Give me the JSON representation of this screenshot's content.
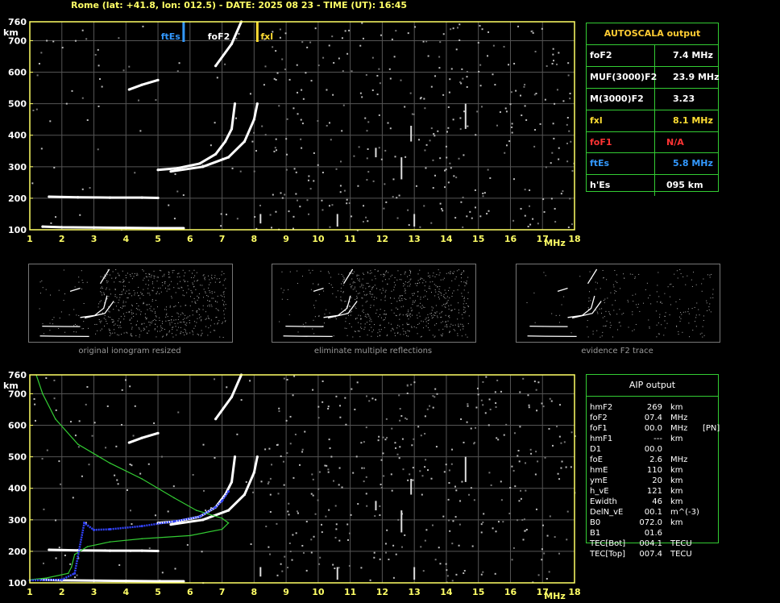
{
  "header": {
    "text": "Rome (lat: +41.8, lon: 012.5) - DATE: 2025 08 23 - TIME (UT): 16:45"
  },
  "colors": {
    "grid": "#555555",
    "axis": "#ffff66",
    "frame": "#33cc33",
    "ftes": "#3399ff",
    "foF1": "#ff3333",
    "fxl": "#ffdd33",
    "profile": "#33cc33",
    "scaled_trace": "#3344ff"
  },
  "top_chart": {
    "xlabel": "MHz",
    "ylabel": "km",
    "x_ticks": [
      "1",
      "2",
      "3",
      "4",
      "5",
      "6",
      "7",
      "8",
      "9",
      "10",
      "11",
      "12",
      "13",
      "14",
      "15",
      "16",
      "17",
      "18"
    ],
    "y_ticks": [
      "100",
      "200",
      "300",
      "400",
      "500",
      "600",
      "700",
      "760"
    ],
    "markers": [
      {
        "label": "ftEs",
        "freq": 5.8
      },
      {
        "label": "foF2",
        "freq": 7.4
      },
      {
        "label": "fxl",
        "freq": 8.1
      }
    ]
  },
  "bottom_chart": {
    "xlabel": "MHz",
    "ylabel": "km",
    "x_ticks": [
      "1",
      "2",
      "3",
      "4",
      "5",
      "6",
      "7",
      "8",
      "9",
      "10",
      "11",
      "12",
      "13",
      "14",
      "15",
      "16",
      "17",
      "18"
    ],
    "y_ticks": [
      "100",
      "200",
      "300",
      "400",
      "500",
      "600",
      "700",
      "760"
    ]
  },
  "thumbnails": [
    {
      "caption": "original ionogram resized"
    },
    {
      "caption": "eliminate multiple reflections"
    },
    {
      "caption": "evidence F2 trace"
    }
  ],
  "autoscala": {
    "title": "AUTOSCALA output",
    "rows": [
      {
        "key": "foF2",
        "value": "7.4  MHz",
        "color": "#ffffff"
      },
      {
        "key": "MUF(3000)F2",
        "value": "23.9  MHz",
        "color": "#ffffff"
      },
      {
        "key": "M(3000)F2",
        "value": "3.23",
        "color": "#ffffff"
      },
      {
        "key": "fxl",
        "value": "8.1  MHz",
        "color": "#ffdd33"
      },
      {
        "key": "foF1",
        "value": "N/A",
        "color": "#ff3333"
      },
      {
        "key": "ftEs",
        "value": "5.8  MHz",
        "color": "#3399ff"
      },
      {
        "key": "h'Es",
        "value": "095     km",
        "color": "#ffffff"
      }
    ]
  },
  "aip": {
    "title": "AIP output",
    "rows": [
      {
        "k": "hmF2",
        "v": "269",
        "u": "km",
        "x": ""
      },
      {
        "k": "foF2",
        "v": "07.4",
        "u": "MHz",
        "x": ""
      },
      {
        "k": "foF1",
        "v": "00.0",
        "u": "MHz",
        "x": "[PN]"
      },
      {
        "k": "hmF1",
        "v": "---",
        "u": "km",
        "x": ""
      },
      {
        "k": "D1",
        "v": "00.0",
        "u": "",
        "x": ""
      },
      {
        "k": "foE",
        "v": "2.6",
        "u": "MHz",
        "x": ""
      },
      {
        "k": "hmE",
        "v": "110",
        "u": "km",
        "x": ""
      },
      {
        "k": "ymE",
        "v": "20",
        "u": "km",
        "x": ""
      },
      {
        "k": "h_vE",
        "v": "121",
        "u": "km",
        "x": ""
      },
      {
        "k": "Ewidth",
        "v": "46",
        "u": "km",
        "x": ""
      },
      {
        "k": "DelN_vE",
        "v": "00.1",
        "u": "m^(-3)",
        "x": ""
      },
      {
        "k": "B0",
        "v": "072.0",
        "u": "km",
        "x": ""
      },
      {
        "k": "B1",
        "v": "01.6",
        "u": "",
        "x": ""
      },
      {
        "k": "TEC[Bot]",
        "v": "004.1",
        "u": "TECU",
        "x": ""
      },
      {
        "k": "TEC[Top]",
        "v": "007.4",
        "u": "TECU",
        "x": ""
      }
    ]
  },
  "chart_data": [
    {
      "type": "scatter",
      "title": "",
      "xlabel": "MHz",
      "ylabel": "km",
      "xlim": [
        1,
        18
      ],
      "ylim": [
        100,
        760
      ],
      "series": [
        {
          "name": "",
          "points": [
            [
              1.4,
              110
            ],
            [
              2.0,
              108
            ],
            [
              3.0,
              107
            ],
            [
              4.0,
              106
            ],
            [
              5.0,
              105
            ],
            [
              5.8,
              105
            ],
            [
              1.6,
              205
            ],
            [
              2.5,
              203
            ],
            [
              3.5,
              202
            ],
            [
              4.5,
              202
            ],
            [
              5.0,
              201
            ],
            [
              5.0,
              290
            ],
            [
              5.6,
              295
            ],
            [
              6.3,
              310
            ],
            [
              6.8,
              340
            ],
            [
              7.1,
              380
            ],
            [
              7.3,
              420
            ],
            [
              7.4,
              500
            ],
            [
              5.4,
              285
            ],
            [
              6.4,
              300
            ],
            [
              7.2,
              330
            ],
            [
              7.7,
              380
            ],
            [
              8.0,
              450
            ],
            [
              8.1,
              500
            ],
            [
              4.1,
              545
            ],
            [
              4.5,
              560
            ],
            [
              5.0,
              575
            ],
            [
              6.8,
              620
            ],
            [
              7.3,
              690
            ],
            [
              7.6,
              760
            ]
          ]
        }
      ]
    },
    {
      "type": "line",
      "title": "",
      "xlabel": "MHz",
      "ylabel": "km",
      "xlim": [
        1,
        18
      ],
      "ylim": [
        100,
        760
      ],
      "series": [
        {
          "name": "",
          "points": [
            [
              1.2,
              760
            ],
            [
              1.4,
              700
            ],
            [
              1.8,
              620
            ],
            [
              2.5,
              540
            ],
            [
              3.5,
              480
            ],
            [
              4.5,
              430
            ],
            [
              5.5,
              370
            ],
            [
              6.2,
              330
            ],
            [
              7.0,
              305
            ],
            [
              7.2,
              290
            ],
            [
              7.0,
              270
            ],
            [
              6.0,
              250
            ],
            [
              4.5,
              240
            ],
            [
              3.5,
              230
            ],
            [
              2.8,
              215
            ],
            [
              2.4,
              190
            ],
            [
              2.3,
              150
            ],
            [
              2.2,
              130
            ],
            [
              1.5,
              115
            ],
            [
              1.0,
              110
            ]
          ]
        },
        {
          "name": "",
          "points": [
            [
              1.0,
              108
            ],
            [
              2.0,
              110
            ],
            [
              2.4,
              130
            ],
            [
              2.7,
              290
            ],
            [
              3.0,
              268
            ],
            [
              3.5,
              270
            ],
            [
              4.5,
              280
            ],
            [
              5.5,
              295
            ],
            [
              6.3,
              310
            ],
            [
              6.8,
              340
            ],
            [
              7.0,
              360
            ],
            [
              7.2,
              390
            ]
          ]
        }
      ]
    }
  ]
}
